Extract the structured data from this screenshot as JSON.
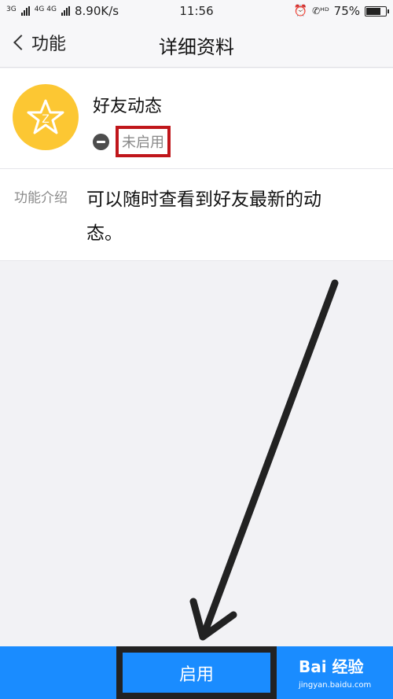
{
  "status_bar": {
    "signal_1": "3G",
    "signal_2": "4G 4G",
    "speed": "8.90K/s",
    "time": "11:56",
    "battery": "75%",
    "battery_level": 0.75,
    "icons": [
      "alarm-icon",
      "hd-call-icon"
    ]
  },
  "nav": {
    "back_label": "功能",
    "title": "详细资料"
  },
  "feature": {
    "name": "好友动态",
    "status": "未启用",
    "avatar_color": "#fcc733"
  },
  "intro": {
    "label": "功能介绍",
    "text": "可以随时查看到好友最新的动态。"
  },
  "bottom": {
    "enable_label": "启用",
    "accent_color": "#1a8cff"
  },
  "watermark": {
    "brand": "Bai 经验",
    "url": "jingyan.baidu.com"
  }
}
